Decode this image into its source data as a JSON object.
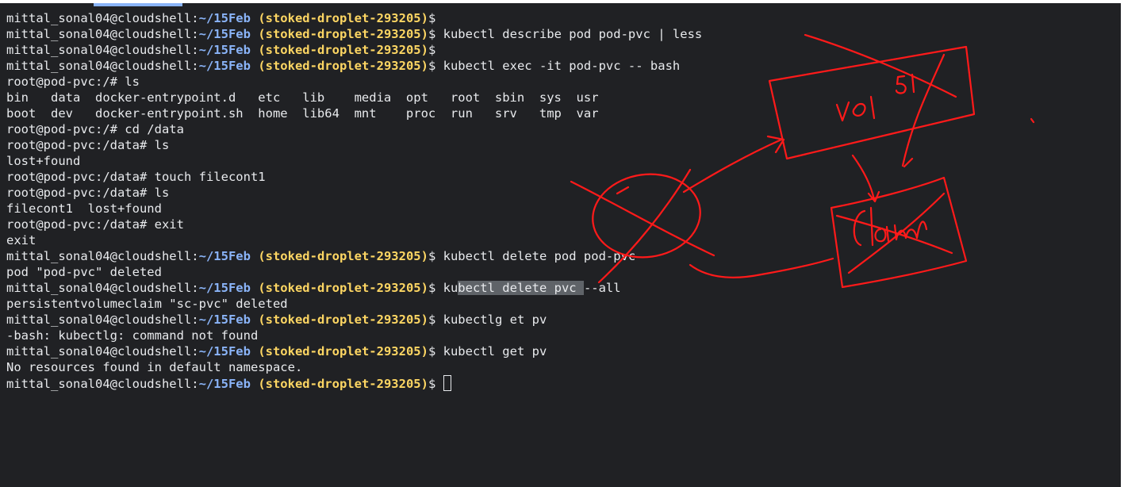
{
  "prompt": {
    "user": "mittal_sonal04@cloudshell:",
    "path": "~/15Feb",
    "project": "(stoked-droplet-293205)",
    "symbol": "$"
  },
  "lines": [
    {
      "type": "prompt",
      "cmd": ""
    },
    {
      "type": "prompt",
      "cmd": "kubectl describe pod pod-pvc | less"
    },
    {
      "type": "prompt",
      "cmd": ""
    },
    {
      "type": "prompt",
      "cmd": "kubectl exec -it pod-pvc -- bash"
    },
    {
      "type": "output",
      "text": "root@pod-pvc:/# ls"
    },
    {
      "type": "output",
      "text": "bin   data  docker-entrypoint.d   etc   lib    media  opt   root  sbin  sys  usr"
    },
    {
      "type": "output",
      "text": "boot  dev   docker-entrypoint.sh  home  lib64  mnt    proc  run   srv   tmp  var"
    },
    {
      "type": "output",
      "text": "root@pod-pvc:/# cd /data"
    },
    {
      "type": "output",
      "text": "root@pod-pvc:/data# ls"
    },
    {
      "type": "output",
      "text": "lost+found"
    },
    {
      "type": "output",
      "text": "root@pod-pvc:/data# touch filecont1"
    },
    {
      "type": "output",
      "text": "root@pod-pvc:/data# ls"
    },
    {
      "type": "output",
      "text": "filecont1  lost+found"
    },
    {
      "type": "output",
      "text": "root@pod-pvc:/data# exit"
    },
    {
      "type": "output",
      "text": "exit"
    },
    {
      "type": "prompt",
      "cmd": "kubectl delete pod pod-pvc"
    },
    {
      "type": "output",
      "text": "pod \"pod-pvc\" deleted"
    },
    {
      "type": "prompt-sel",
      "pre": "ku",
      "sel": "bectl delete pvc ",
      "post": "--all"
    },
    {
      "type": "output",
      "text": "persistentvolumeclaim \"sc-pvc\" deleted"
    },
    {
      "type": "prompt",
      "cmd": "kubectlg et pv"
    },
    {
      "type": "output",
      "text": "-bash: kubectlg: command not found"
    },
    {
      "type": "prompt",
      "cmd": "kubectl get pv"
    },
    {
      "type": "output",
      "text": "No resources found in default namespace."
    },
    {
      "type": "prompt-cursor",
      "cmd": ""
    }
  ],
  "annotation_color": "#ff1a1a"
}
